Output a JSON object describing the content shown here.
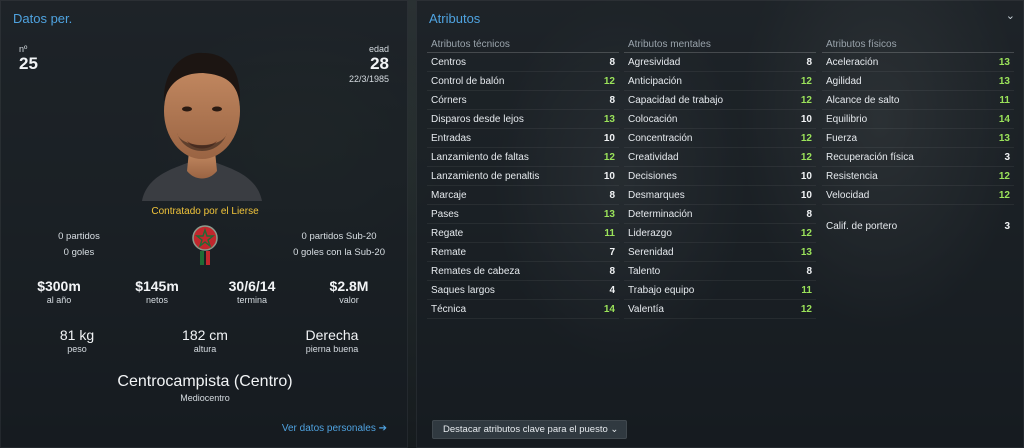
{
  "left": {
    "title": "Datos per.",
    "number_label": "nº",
    "number": "25",
    "age_label": "edad",
    "age": "28",
    "dob": "22/3/1985",
    "signed_text": "Contratado por el Lierse",
    "caps": {
      "matches": "0 partidos",
      "goals": "0 goles"
    },
    "u20": {
      "matches": "0 partidos Sub-20",
      "goals": "0 goles con la Sub-20"
    },
    "contract": [
      {
        "value": "$300m",
        "label": "al año"
      },
      {
        "value": "$145m",
        "label": "netos"
      },
      {
        "value": "30/6/14",
        "label": "termina"
      },
      {
        "value": "$2.8M",
        "label": "valor"
      }
    ],
    "physical": [
      {
        "value": "81 kg",
        "label": "peso"
      },
      {
        "value": "182 cm",
        "label": "altura"
      },
      {
        "value": "Derecha",
        "label": "pierna buena"
      }
    ],
    "position_main": "Centrocampista (Centro)",
    "position_sub": "Mediocentro",
    "link": "Ver datos personales"
  },
  "right": {
    "title": "Atributos",
    "collapse_icon": "chevron-down-icon",
    "columns": [
      {
        "header": "Atributos técnicos",
        "rows": [
          {
            "name": "Centros",
            "value": "8"
          },
          {
            "name": "Control de balón",
            "value": "12"
          },
          {
            "name": "Córners",
            "value": "8"
          },
          {
            "name": "Disparos desde lejos",
            "value": "13"
          },
          {
            "name": "Entradas",
            "value": "10"
          },
          {
            "name": "Lanzamiento de faltas",
            "value": "12"
          },
          {
            "name": "Lanzamiento de penaltis",
            "value": "10"
          },
          {
            "name": "Marcaje",
            "value": "8"
          },
          {
            "name": "Pases",
            "value": "13"
          },
          {
            "name": "Regate",
            "value": "11"
          },
          {
            "name": "Remate",
            "value": "7"
          },
          {
            "name": "Remates de cabeza",
            "value": "8"
          },
          {
            "name": "Saques largos",
            "value": "4"
          },
          {
            "name": "Técnica",
            "value": "14"
          }
        ]
      },
      {
        "header": "Atributos mentales",
        "rows": [
          {
            "name": "Agresividad",
            "value": "8"
          },
          {
            "name": "Anticipación",
            "value": "12"
          },
          {
            "name": "Capacidad de trabajo",
            "value": "12"
          },
          {
            "name": "Colocación",
            "value": "10"
          },
          {
            "name": "Concentración",
            "value": "12"
          },
          {
            "name": "Creatividad",
            "value": "12"
          },
          {
            "name": "Decisiones",
            "value": "10"
          },
          {
            "name": "Desmarques",
            "value": "10"
          },
          {
            "name": "Determinación",
            "value": "8"
          },
          {
            "name": "Liderazgo",
            "value": "12"
          },
          {
            "name": "Serenidad",
            "value": "13"
          },
          {
            "name": "Talento",
            "value": "8"
          },
          {
            "name": "Trabajo equipo",
            "value": "11"
          },
          {
            "name": "Valentía",
            "value": "12"
          }
        ]
      },
      {
        "header": "Atributos físicos",
        "rows": [
          {
            "name": "Aceleración",
            "value": "13"
          },
          {
            "name": "Agilidad",
            "value": "13"
          },
          {
            "name": "Alcance de salto",
            "value": "11"
          },
          {
            "name": "Equilibrio",
            "value": "14"
          },
          {
            "name": "Fuerza",
            "value": "13"
          },
          {
            "name": "Recuperación física",
            "value": "3"
          },
          {
            "name": "Resistencia",
            "value": "12"
          },
          {
            "name": "Velocidad",
            "value": "12"
          }
        ],
        "goalkeeper": {
          "name": "Calif. de portero",
          "value": "3"
        }
      }
    ],
    "highlight_button": "Destacar atributos clave para el puesto"
  },
  "colors": {
    "accent": "#4fa3e0",
    "good": "#9be35a",
    "signed": "#f1c43a"
  }
}
